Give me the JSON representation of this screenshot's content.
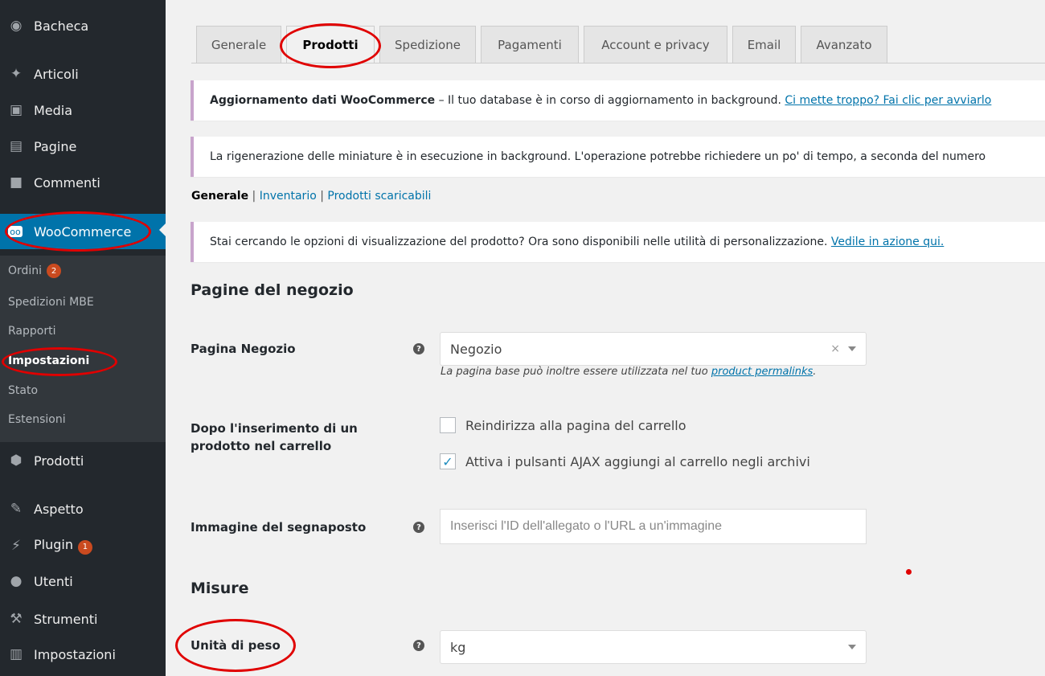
{
  "sidebar": {
    "items": [
      {
        "label": "Bacheca",
        "icon": "dashboard-icon"
      },
      {
        "label": "Articoli",
        "icon": "pin-icon"
      },
      {
        "label": "Media",
        "icon": "media-icon"
      },
      {
        "label": "Pagine",
        "icon": "page-icon"
      },
      {
        "label": "Commenti",
        "icon": "comment-icon"
      },
      {
        "label": "WooCommerce",
        "icon": "woocommerce-icon"
      },
      {
        "label": "Prodotti",
        "icon": "box-icon"
      },
      {
        "label": "Aspetto",
        "icon": "brush-icon"
      },
      {
        "label": "Plugin",
        "icon": "plugin-icon",
        "badge": "1"
      },
      {
        "label": "Utenti",
        "icon": "users-icon"
      },
      {
        "label": "Strumenti",
        "icon": "wrench-icon"
      },
      {
        "label": "Impostazioni",
        "icon": "settings-icon"
      }
    ],
    "submenu": [
      {
        "label": "Ordini",
        "badge": "2"
      },
      {
        "label": "Spedizioni MBE"
      },
      {
        "label": "Rapporti"
      },
      {
        "label": "Impostazioni"
      },
      {
        "label": "Stato"
      },
      {
        "label": "Estensioni"
      }
    ]
  },
  "tabs": [
    "Generale",
    "Prodotti",
    "Spedizione",
    "Pagamenti",
    "Account e privacy",
    "Email",
    "Avanzato"
  ],
  "notices": {
    "update": {
      "strong": "Aggiornamento dati WooCommerce",
      "text": " – Il tuo database è in corso di aggiornamento in background. ",
      "link": "Ci mette troppo? Fai clic per avviarlo"
    },
    "thumbnails": "La rigenerazione delle miniature è in esecuzione in background. L'operazione potrebbe richiedere un po' di tempo, a seconda del numero",
    "display": {
      "text": "Stai cercando le opzioni di visualizzazione del prodotto? Ora sono disponibili nelle utilità di personalizzazione. ",
      "link": "Vedile in azione qui."
    }
  },
  "subsubsub": {
    "current": "Generale",
    "sep": " | ",
    "links": [
      "Inventario",
      "Prodotti scaricabili"
    ]
  },
  "sections": {
    "shop_pages": "Pagine del negozio",
    "measures": "Misure"
  },
  "fields": {
    "shop_page": {
      "label": "Pagina Negozio",
      "value": "Negozio",
      "clear": "×",
      "desc_text": "La pagina base può inoltre essere utilizzata nel tuo ",
      "desc_link": "product permalinks",
      "desc_end": "."
    },
    "add_to_cart": {
      "label_line1": "Dopo l'inserimento di un",
      "label_line2": "prodotto nel carrello",
      "options": [
        {
          "label": "Reindirizza alla pagina del carrello",
          "checked": false
        },
        {
          "label": "Attiva i pulsanti AJAX aggiungi al carrello negli archivi",
          "checked": true
        }
      ]
    },
    "placeholder_image": {
      "label": "Immagine del segnaposto",
      "placeholder": "Inserisci l'ID dell'allegato o l'URL a un'immagine"
    },
    "weight_unit": {
      "label": "Unità di peso",
      "value": "kg"
    }
  },
  "help_glyph": "?",
  "check_glyph": "✓",
  "colors": {
    "sidebar_bg": "#23282d",
    "active_blue": "#0073aa",
    "notice_border": "#c8a4cc",
    "badge": "#ca4a1f",
    "annotation_red": "#e00000"
  }
}
